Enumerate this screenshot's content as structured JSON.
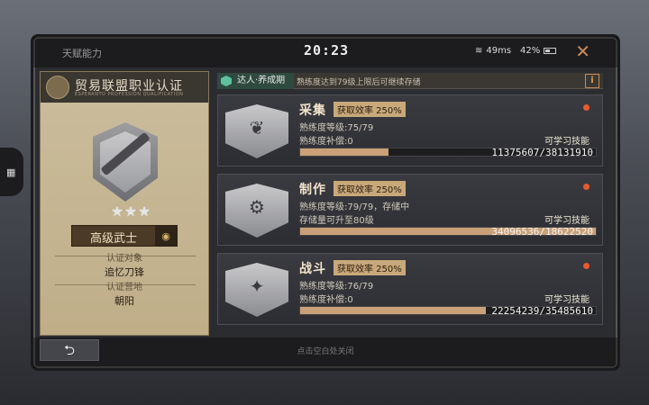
{
  "status_bar": {
    "title": "天赋能力",
    "time": "20:23",
    "network": "49ms",
    "battery": "42%"
  },
  "certification": {
    "title": "贸易联盟职业认证",
    "subtitle": "ESPERANTO PROFESSION QUALIFICATION",
    "rank": "高级武士",
    "stars": 3,
    "target_label": "认证对象",
    "target_value": "追忆刀锋",
    "camp_label": "认证营地",
    "camp_value": "朝阳"
  },
  "tag": {
    "chip": "达人·养成期",
    "text": "熟练度达到79级上限后可继续存储"
  },
  "skills": [
    {
      "name": "采集",
      "efficiency": "获取效率 250%",
      "line1": "熟练度等级:75/79",
      "line2": "熟练度补偿:0",
      "learn": "可学习技能",
      "progress_text": "11375607/38131910",
      "progress": 0.298,
      "glyph": "❦"
    },
    {
      "name": "制作",
      "efficiency": "获取效率 250%",
      "line1": "熟练度等级:79/79，存储中",
      "line2": "存储量可升至80级",
      "learn": "可学习技能",
      "progress_text": "34096536/18622520",
      "progress": 1.0,
      "glyph": "⚙"
    },
    {
      "name": "战斗",
      "efficiency": "获取效率 250%",
      "line1": "熟练度等级:76/79",
      "line2": "熟练度补偿:0",
      "learn": "可学习技能",
      "progress_text": "22254239/35485610",
      "progress": 0.627,
      "glyph": "✦"
    }
  ],
  "footer": {
    "back_label": "⮌",
    "hint": "点击空白处关闭"
  },
  "colors": {
    "accent": "#c9a078",
    "alert_dot": "#e85a2e",
    "close": "#c98b5a"
  }
}
